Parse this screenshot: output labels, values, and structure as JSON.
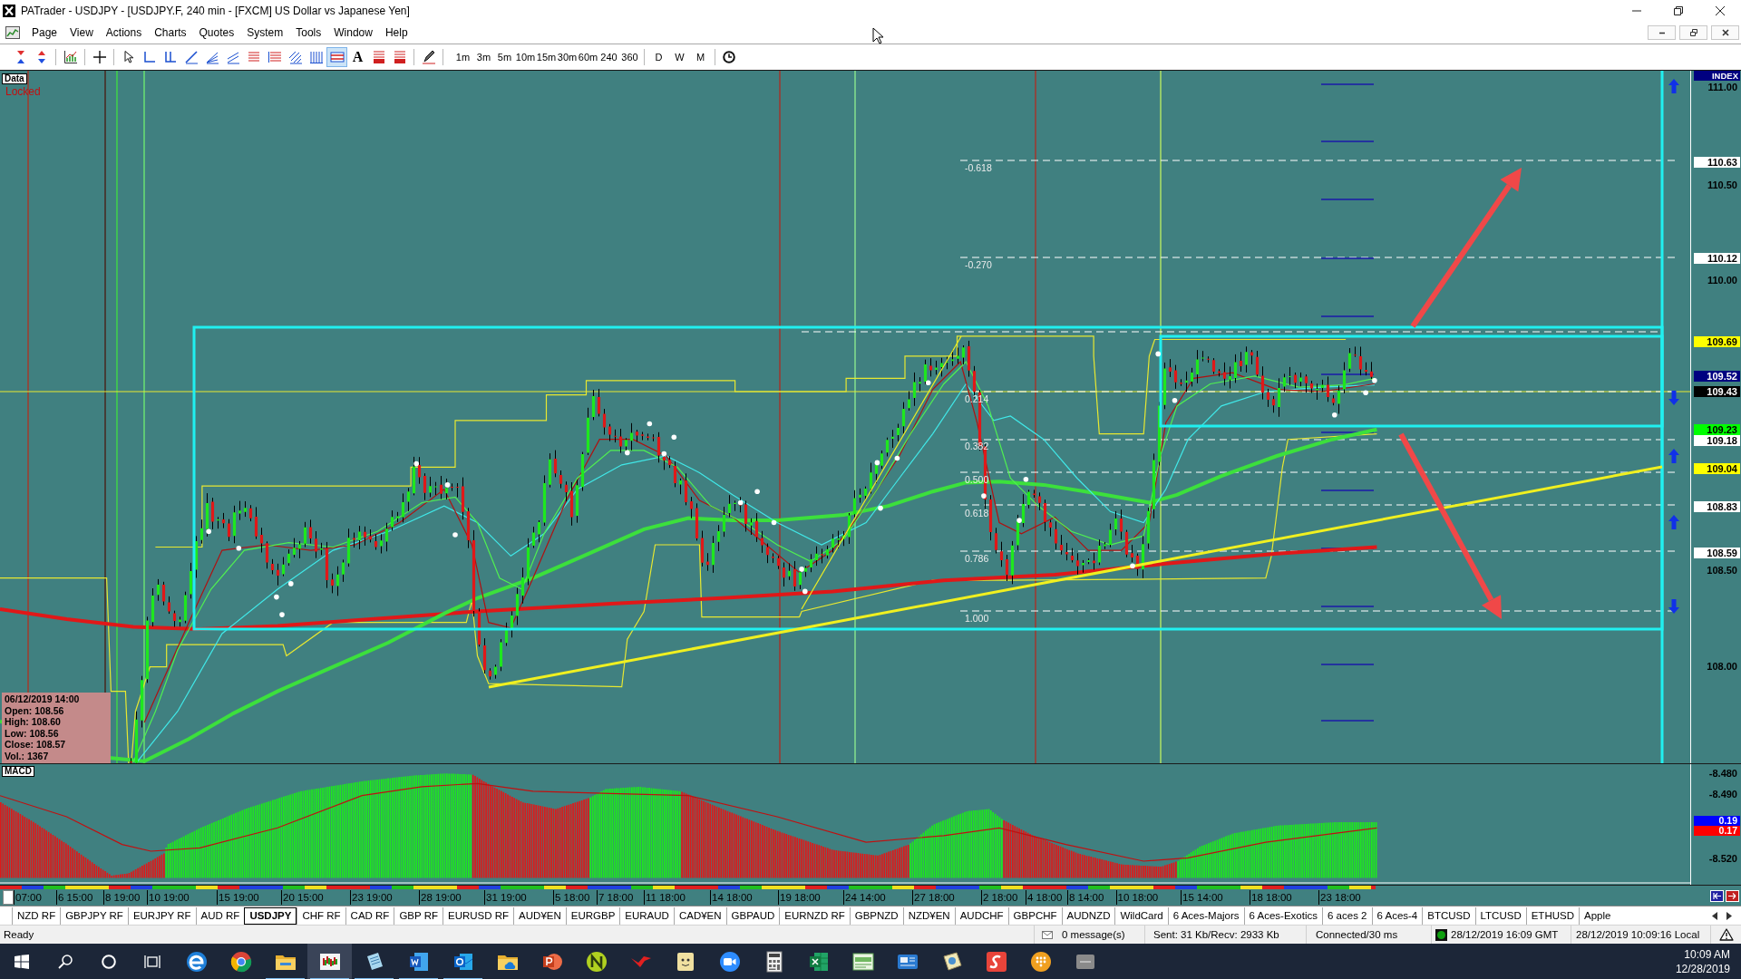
{
  "window": {
    "title": "PATrader - USDJPY - [USDJPY.F, 240 min - [FXCM] US Dollar vs Japanese Yen]"
  },
  "menu": [
    "Page",
    "View",
    "Actions",
    "Charts",
    "Quotes",
    "System",
    "Tools",
    "Window",
    "Help"
  ],
  "toolbar": {
    "tools": [
      {
        "selected": false
      },
      {
        "selected": false
      },
      {
        "selected": false
      },
      {
        "selected": false
      },
      {
        "selected": false
      },
      {
        "selected": false
      },
      {
        "selected": false
      },
      {
        "selected": false
      },
      {
        "selected": false
      },
      {
        "selected": false
      },
      {
        "selected": false
      },
      {
        "selected": false
      },
      {
        "selected": false
      },
      {
        "selected": false
      },
      {
        "selected": true
      },
      {
        "selected": false,
        "glyph": "A"
      },
      {
        "selected": false
      },
      {
        "selected": false
      },
      {
        "selected": false
      }
    ],
    "timeframes": [
      "1m",
      "3m",
      "5m",
      "10m",
      "15m",
      "30m",
      "60m",
      "240",
      "360"
    ],
    "periods": [
      "D",
      "W",
      "M"
    ]
  },
  "chart": {
    "data_label": "Data",
    "lock_status": "Locked",
    "fib_levels": [
      "-0.618",
      "-0.270",
      "0.214",
      "0.382",
      "0.500",
      "0.618",
      "0.786",
      "1.000"
    ],
    "info_box": {
      "timestamp": "06/12/2019 14:00",
      "lines": [
        "Open: 108.56",
        "High: 108.60",
        "Low: 108.56",
        "Close: 108.57",
        "Vol.: 1367"
      ]
    },
    "price_axis": {
      "header": "INDEX",
      "labels": [
        "111.00",
        "110.50",
        "110.00",
        "108.50",
        "108.00"
      ]
    },
    "price_tags": [
      {
        "text": "110.63",
        "color": "#ffffff"
      },
      {
        "text": "110.12",
        "color": "#ffffff"
      },
      {
        "text": "109.69",
        "color": "#ffff00"
      },
      {
        "text": "109.52",
        "color": "#000080"
      },
      {
        "text": "109.43",
        "color": "#000000"
      },
      {
        "text": "109.23",
        "color": "#00ff00"
      },
      {
        "text": "109.18",
        "color": "#ffffff"
      },
      {
        "text": "109.04",
        "color": "#ffff00"
      },
      {
        "text": "108.83",
        "color": "#ffffff"
      },
      {
        "text": "108.59",
        "color": "#ffffff"
      }
    ],
    "macd": {
      "label": "MACD",
      "axis_labels": [
        "-8.480",
        "-8.490",
        "-8.520"
      ],
      "tags": [
        {
          "text": "0.19",
          "color": "#0000ff"
        },
        {
          "text": "0.17",
          "color": "#ff0000"
        }
      ]
    },
    "time_labels": [
      "07:00",
      "6 15:00",
      "8 19:00",
      "10 19:00",
      "15 19:00",
      "20 15:00",
      "23 19:00",
      "28 19:00",
      "31 19:00",
      "5 18:00",
      "7 18:00",
      "11 18:00",
      "14 18:00",
      "19 18:00",
      "24 14:00",
      "27 18:00",
      "2 18:00",
      "4 18:00",
      "8 14:00",
      "10 18:00",
      "15 14:00",
      "18 18:00",
      "23 18:00"
    ]
  },
  "tabs": [
    {
      "label": "NZD RF",
      "selected": false
    },
    {
      "label": "GBPJPY RF",
      "selected": false
    },
    {
      "label": "EURJPY RF",
      "selected": false
    },
    {
      "label": "AUD RF",
      "selected": false
    },
    {
      "label": "USDJPY",
      "selected": true
    },
    {
      "label": "CHF RF",
      "selected": false
    },
    {
      "label": "CAD RF",
      "selected": false
    },
    {
      "label": "GBP RF",
      "selected": false
    },
    {
      "label": "EURUSD RF",
      "selected": false
    },
    {
      "label": "AUD¥EN",
      "selected": false
    },
    {
      "label": "EURGBP",
      "selected": false
    },
    {
      "label": "EURAUD",
      "selected": false
    },
    {
      "label": "CAD¥EN",
      "selected": false
    },
    {
      "label": "GBPAUD",
      "selected": false
    },
    {
      "label": "EURNZD RF",
      "selected": false
    },
    {
      "label": "GBPNZD",
      "selected": false
    },
    {
      "label": "NZD¥EN",
      "selected": false
    },
    {
      "label": "AUDCHF",
      "selected": false
    },
    {
      "label": "GBPCHF",
      "selected": false
    },
    {
      "label": "AUDNZD",
      "selected": false
    },
    {
      "label": "WildCard",
      "selected": false
    },
    {
      "label": "6 Aces-Majors",
      "selected": false
    },
    {
      "label": "6 Aces-Exotics",
      "selected": false
    },
    {
      "label": "6 aces 2",
      "selected": false
    },
    {
      "label": "6 Aces-4",
      "selected": false
    },
    {
      "label": "BTCUSD",
      "selected": false
    },
    {
      "label": "LTCUSD",
      "selected": false
    },
    {
      "label": "ETHUSD",
      "selected": false
    },
    {
      "label": "Apple",
      "selected": false
    }
  ],
  "status_bar": {
    "state": "Ready",
    "messages": "0 message(s)",
    "traffic": "Sent: 31 Kb/Recv: 2933 Kb",
    "connection": "Connected/30 ms",
    "server_time": "28/12/2019 16:09 GMT",
    "local_time": "28/12/2019 10:09:16 Local"
  },
  "taskbar": {
    "apps": [
      {
        "running": false,
        "selected": false
      },
      {
        "running": false,
        "selected": false
      },
      {
        "running": true,
        "selected": false
      },
      {
        "running": true,
        "selected": true
      },
      {
        "running": true,
        "selected": false
      },
      {
        "running": true,
        "selected": false
      },
      {
        "running": true,
        "selected": false
      },
      {
        "running": false,
        "selected": false
      },
      {
        "running": false,
        "selected": false
      },
      {
        "running": false,
        "selected": false
      },
      {
        "running": false,
        "selected": false
      },
      {
        "running": false,
        "selected": false
      },
      {
        "running": false,
        "selected": false
      },
      {
        "running": false,
        "selected": false
      },
      {
        "running": false,
        "selected": false
      },
      {
        "running": false,
        "selected": false
      },
      {
        "running": false,
        "selected": false
      },
      {
        "running": false,
        "selected": false
      },
      {
        "running": false,
        "selected": false
      },
      {
        "running": false,
        "selected": false
      },
      {
        "running": false,
        "selected": false
      }
    ],
    "time": "10:09 AM",
    "date": "12/28/2019"
  }
}
